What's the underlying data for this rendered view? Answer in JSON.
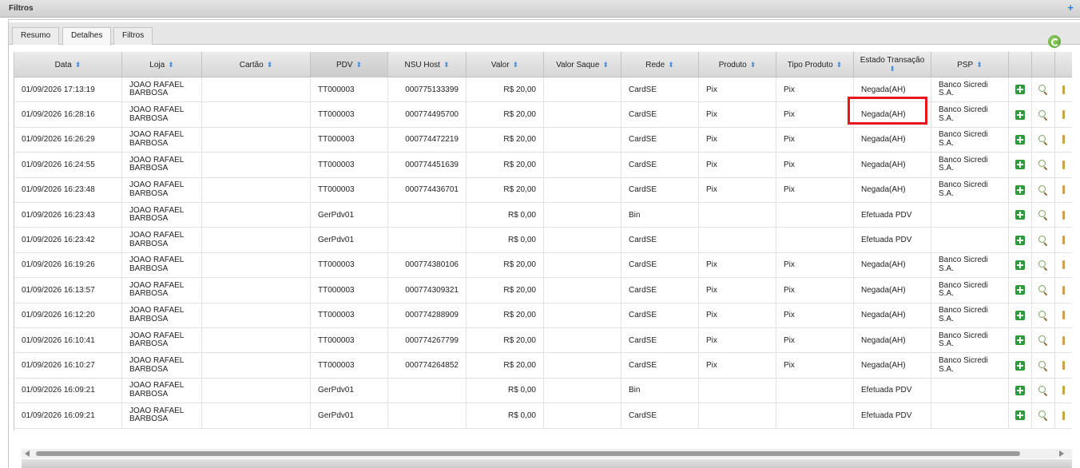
{
  "filter_bar": {
    "title": "Filtros",
    "expand_label": "+"
  },
  "tabs": [
    {
      "label": "Resumo"
    },
    {
      "label": "Detalhes"
    },
    {
      "label": "Filtros"
    }
  ],
  "active_tab": "Detalhes",
  "icons": {
    "refresh": "refresh-icon",
    "add": "add-icon",
    "details": "magnifier-icon",
    "more": "more-icon"
  },
  "colors": {
    "highlight": "#e8161b",
    "add_icon": "#2f9a3b",
    "sort_icon": "#4a8fd8"
  },
  "columns": {
    "data": "Data",
    "loja": "Loja",
    "cartao": "Cartão",
    "pdv": "PDV",
    "nsu": "NSU Host",
    "valor": "Valor",
    "saque": "Valor Saque",
    "rede": "Rede",
    "produto": "Produto",
    "tipo": "Tipo Produto",
    "estado": "Estado Transação",
    "psp": "PSP",
    "sort_glyph": "⬍"
  },
  "rows": [
    {
      "data": "01/09/2026 17:13:19",
      "loja": "JOAO RAFAEL BARBOSA",
      "cartao": "",
      "pdv": "TT000003",
      "nsu": "000775133399",
      "valor": "R$ 20,00",
      "saque": "",
      "rede": "CardSE",
      "produto": "Pix",
      "tipo": "Pix",
      "estado": "Negada(AH)",
      "psp": "Banco Sicredi S.A."
    },
    {
      "data": "01/09/2026 16:28:16",
      "loja": "JOAO RAFAEL BARBOSA",
      "cartao": "",
      "pdv": "TT000003",
      "nsu": "000774495700",
      "valor": "R$ 20,00",
      "saque": "",
      "rede": "CardSE",
      "produto": "Pix",
      "tipo": "Pix",
      "estado": "Negada(AH)",
      "psp": "Banco Sicredi S.A."
    },
    {
      "data": "01/09/2026 16:26:29",
      "loja": "JOAO RAFAEL BARBOSA",
      "cartao": "",
      "pdv": "TT000003",
      "nsu": "000774472219",
      "valor": "R$ 20,00",
      "saque": "",
      "rede": "CardSE",
      "produto": "Pix",
      "tipo": "Pix",
      "estado": "Negada(AH)",
      "psp": "Banco Sicredi S.A."
    },
    {
      "data": "01/09/2026 16:24:55",
      "loja": "JOAO RAFAEL BARBOSA",
      "cartao": "",
      "pdv": "TT000003",
      "nsu": "000774451639",
      "valor": "R$ 20,00",
      "saque": "",
      "rede": "CardSE",
      "produto": "Pix",
      "tipo": "Pix",
      "estado": "Negada(AH)",
      "psp": "Banco Sicredi S.A."
    },
    {
      "data": "01/09/2026 16:23:48",
      "loja": "JOAO RAFAEL BARBOSA",
      "cartao": "",
      "pdv": "TT000003",
      "nsu": "000774436701",
      "valor": "R$ 20,00",
      "saque": "",
      "rede": "CardSE",
      "produto": "Pix",
      "tipo": "Pix",
      "estado": "Negada(AH)",
      "psp": "Banco Sicredi S.A."
    },
    {
      "data": "01/09/2026 16:23:43",
      "loja": "JOAO RAFAEL BARBOSA",
      "cartao": "",
      "pdv": "GerPdv01",
      "nsu": "",
      "valor": "R$ 0,00",
      "saque": "",
      "rede": "Bin",
      "produto": "",
      "tipo": "",
      "estado": "Efetuada PDV",
      "psp": ""
    },
    {
      "data": "01/09/2026 16:23:42",
      "loja": "JOAO RAFAEL BARBOSA",
      "cartao": "",
      "pdv": "GerPdv01",
      "nsu": "",
      "valor": "R$ 0,00",
      "saque": "",
      "rede": "CardSE",
      "produto": "",
      "tipo": "",
      "estado": "Efetuada PDV",
      "psp": ""
    },
    {
      "data": "01/09/2026 16:19:26",
      "loja": "JOAO RAFAEL BARBOSA",
      "cartao": "",
      "pdv": "TT000003",
      "nsu": "000774380106",
      "valor": "R$ 20,00",
      "saque": "",
      "rede": "CardSE",
      "produto": "Pix",
      "tipo": "Pix",
      "estado": "Negada(AH)",
      "psp": "Banco Sicredi S.A."
    },
    {
      "data": "01/09/2026 16:13:57",
      "loja": "JOAO RAFAEL BARBOSA",
      "cartao": "",
      "pdv": "TT000003",
      "nsu": "000774309321",
      "valor": "R$ 20,00",
      "saque": "",
      "rede": "CardSE",
      "produto": "Pix",
      "tipo": "Pix",
      "estado": "Negada(AH)",
      "psp": "Banco Sicredi S.A."
    },
    {
      "data": "01/09/2026 16:12:20",
      "loja": "JOAO RAFAEL BARBOSA",
      "cartao": "",
      "pdv": "TT000003",
      "nsu": "000774288909",
      "valor": "R$ 20,00",
      "saque": "",
      "rede": "CardSE",
      "produto": "Pix",
      "tipo": "Pix",
      "estado": "Negada(AH)",
      "psp": "Banco Sicredi S.A."
    },
    {
      "data": "01/09/2026 16:10:41",
      "loja": "JOAO RAFAEL BARBOSA",
      "cartao": "",
      "pdv": "TT000003",
      "nsu": "000774267799",
      "valor": "R$ 20,00",
      "saque": "",
      "rede": "CardSE",
      "produto": "Pix",
      "tipo": "Pix",
      "estado": "Negada(AH)",
      "psp": "Banco Sicredi S.A."
    },
    {
      "data": "01/09/2026 16:10:27",
      "loja": "JOAO RAFAEL BARBOSA",
      "cartao": "",
      "pdv": "TT000003",
      "nsu": "000774264852",
      "valor": "R$ 20,00",
      "saque": "",
      "rede": "CardSE",
      "produto": "Pix",
      "tipo": "Pix",
      "estado": "Negada(AH)",
      "psp": "Banco Sicredi S.A."
    },
    {
      "data": "01/09/2026 16:09:21",
      "loja": "JOAO RAFAEL BARBOSA",
      "cartao": "",
      "pdv": "GerPdv01",
      "nsu": "",
      "valor": "R$ 0,00",
      "saque": "",
      "rede": "Bin",
      "produto": "",
      "tipo": "",
      "estado": "Efetuada PDV",
      "psp": ""
    },
    {
      "data": "01/09/2026 16:09:21",
      "loja": "JOAO RAFAEL BARBOSA",
      "cartao": "",
      "pdv": "GerPdv01",
      "nsu": "",
      "valor": "R$ 0,00",
      "saque": "",
      "rede": "CardSE",
      "produto": "",
      "tipo": "",
      "estado": "Efetuada PDV",
      "psp": ""
    }
  ]
}
